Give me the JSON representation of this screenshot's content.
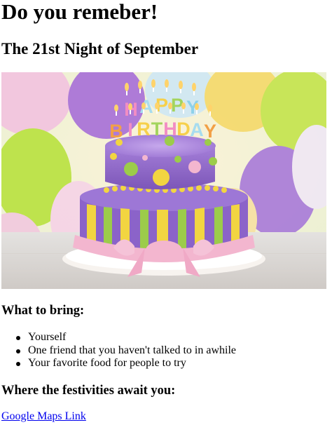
{
  "page": {
    "heading": "Do you remeber!",
    "subheading": "The 21st Night of September"
  },
  "hero_image": {
    "description_icon": "birthday-cake-image",
    "candles_text_line1": "HAPPY",
    "candles_text_line2": "BIRTHDAY"
  },
  "bring": {
    "title": "What to bring:",
    "items": [
      {
        "label": "Yourself"
      },
      {
        "label": "One friend that you haven't talked to in awhile"
      },
      {
        "label": "Your favorite food for people to try"
      }
    ]
  },
  "location": {
    "title": "Where the festivities await you:",
    "link_label": "Google Maps Link"
  },
  "colors": {
    "link": "#0000ee",
    "text": "#000000",
    "cake_purple": "#8b63c9",
    "cake_yellow": "#f2d541",
    "cake_green": "#9ccc4a",
    "ribbon_pink": "#f3b6cf"
  }
}
